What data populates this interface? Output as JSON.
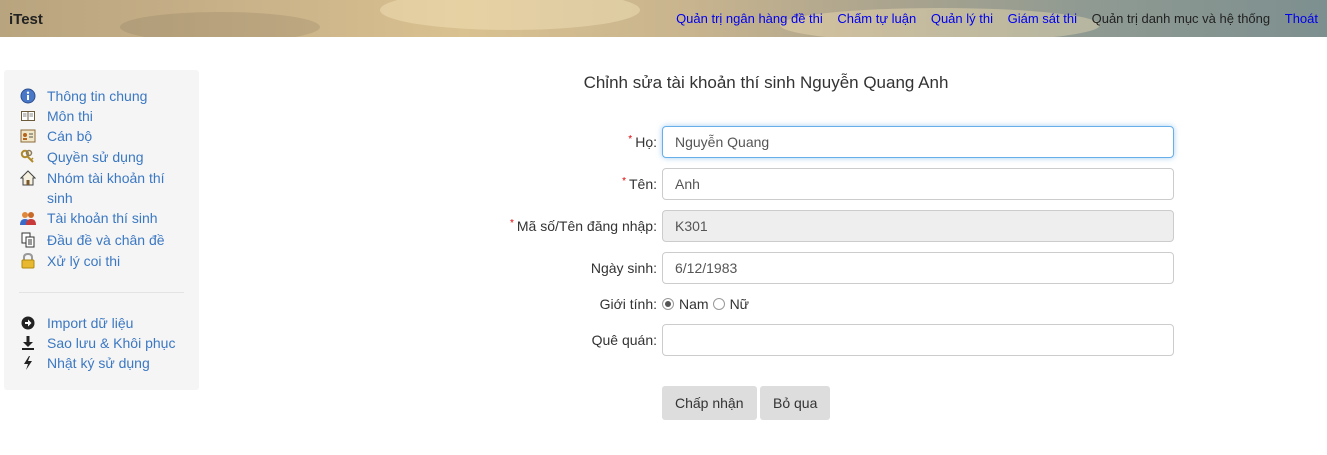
{
  "header": {
    "brand": "iTest",
    "nav": [
      {
        "label": "Quản trị ngân hàng đề thi"
      },
      {
        "label": "Chấm tự luận"
      },
      {
        "label": "Quản lý thi"
      },
      {
        "label": "Giám sát thi"
      },
      {
        "label": "Quản trị danh mục và hệ thống"
      },
      {
        "label": "Thoát"
      }
    ]
  },
  "sidebar": {
    "items": [
      {
        "label": "Thông tin chung",
        "icon": "info-icon"
      },
      {
        "label": "Môn thi",
        "icon": "book-icon"
      },
      {
        "label": "Cán bộ",
        "icon": "id-card-icon"
      },
      {
        "label": "Quyền sử dụng",
        "icon": "keys-icon"
      },
      {
        "label": "Nhóm tài khoản thí sinh",
        "icon": "house-icon"
      },
      {
        "label": "Tài khoản thí sinh",
        "icon": "users-icon"
      },
      {
        "label": "Đầu đề và chân đề",
        "icon": "copy-icon"
      },
      {
        "label": "Xử lý coi thi",
        "icon": "lock-icon"
      }
    ],
    "tools": [
      {
        "label": "Import dữ liệu",
        "icon": "arrow-circle-right-icon"
      },
      {
        "label": "Sao lưu & Khôi phục",
        "icon": "download-icon"
      },
      {
        "label": "Nhật ký sử dụng",
        "icon": "lightning-icon"
      }
    ]
  },
  "form": {
    "title": "Chỉnh sửa tài khoản thí sinh Nguyễn Quang  Anh",
    "required_mark": "*",
    "last_name": {
      "label": "Họ:",
      "value": "Nguyễn Quang"
    },
    "first_name": {
      "label": "Tên:",
      "value": "Anh"
    },
    "username": {
      "label": "Mã số/Tên đăng nhập:",
      "value": "K301"
    },
    "birthday": {
      "label": "Ngày sinh:",
      "value": "6/12/1983"
    },
    "gender": {
      "label": "Giới tính:",
      "options": [
        "Nam",
        "Nữ"
      ],
      "selected": "Nam"
    },
    "hometown": {
      "label": "Quê quán:",
      "value": ""
    },
    "accept_label": "Chấp nhận",
    "cancel_label": "Bỏ qua"
  },
  "colors": {
    "link": "#0000ee",
    "sidebar_link": "#3b78c2",
    "required": "#dd0000",
    "focus": "#66afe9"
  }
}
